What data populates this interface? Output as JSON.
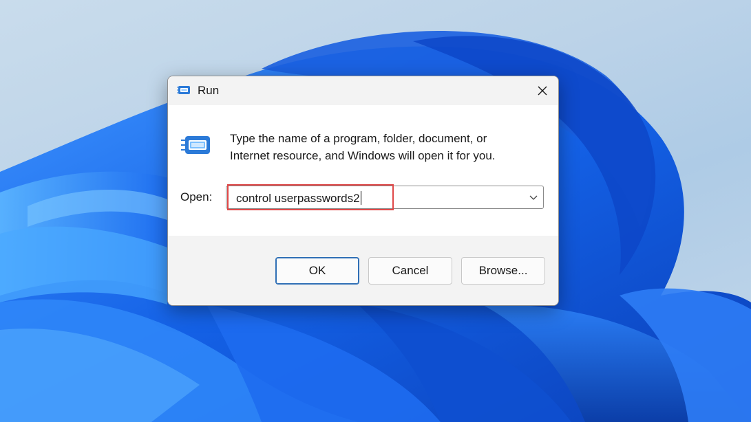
{
  "dialog": {
    "title": "Run",
    "description_line1": "Type the name of a program, folder, document, or",
    "description_line2": "Internet resource, and Windows will open it for you.",
    "open_label": "Open:",
    "open_value": "control userpasswords2",
    "buttons": {
      "ok": "OK",
      "cancel": "Cancel",
      "browse": "Browse..."
    }
  },
  "icons": {
    "title": "run-icon",
    "main": "run-icon",
    "close": "close-icon",
    "dropdown": "chevron-down-icon"
  },
  "colors": {
    "highlight": "#e04848",
    "default_button_border": "#2f6fb5",
    "wallpaper_blue": "#1565e8"
  }
}
